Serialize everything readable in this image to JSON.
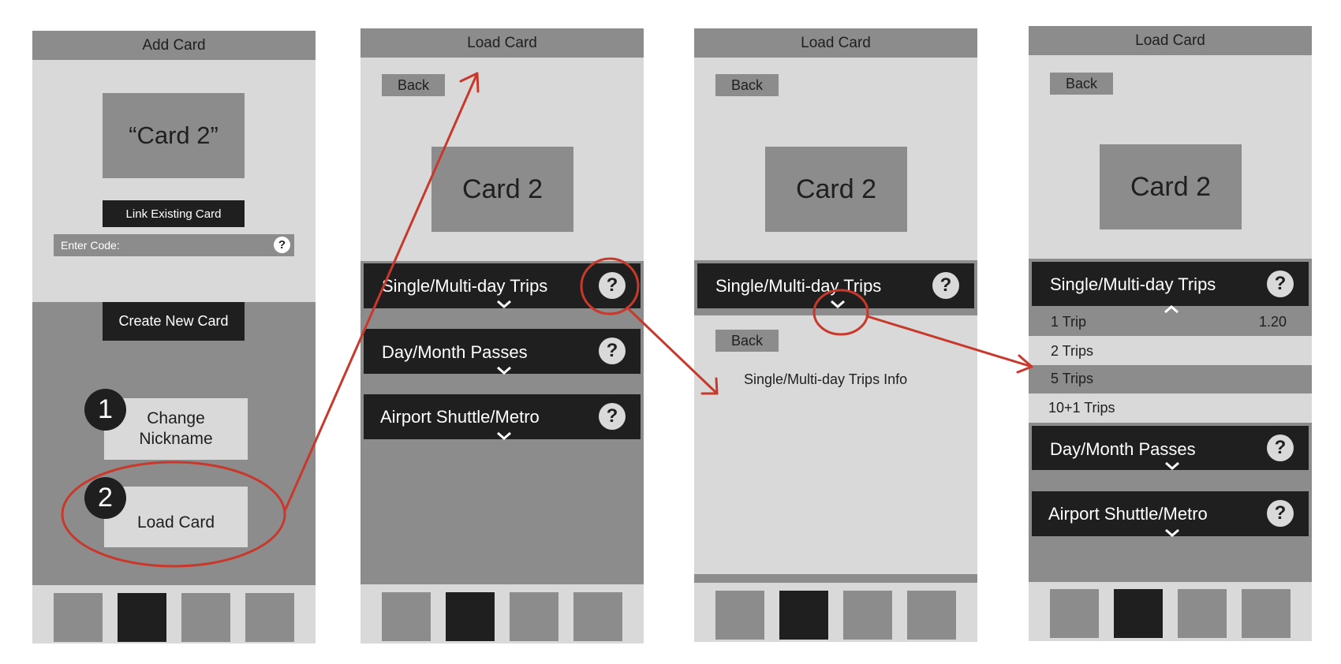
{
  "screens": {
    "add_card": {
      "title": "Add Card",
      "card_name": "“Card 2”",
      "link_button": "Link Existing Card",
      "code_placeholder": "Enter Code:",
      "create_button": "Create New Card",
      "step1_number": "1",
      "change_nickname": "Change Nickname",
      "step2_number": "2",
      "load_card_button": "Load Card"
    },
    "load_card_1": {
      "title": "Load Card",
      "back": "Back",
      "card_name": "Card 2",
      "sections": [
        "Single/Multi-day Trips",
        "Day/Month Passes",
        "Airport Shuttle/Metro"
      ]
    },
    "load_card_2": {
      "title": "Load Card",
      "back": "Back",
      "card_name": "Card 2",
      "section": "Single/Multi-day Trips",
      "info_back": "Back",
      "info_text": "Single/Multi-day Trips Info"
    },
    "load_card_3": {
      "title": "Load Card",
      "back": "Back",
      "card_name": "Card 2",
      "section": "Single/Multi-day Trips",
      "options": [
        {
          "label": "1 Trip",
          "price": "1.20"
        },
        {
          "label": "2 Trips",
          "price": ""
        },
        {
          "label": "5 Trips",
          "price": ""
        },
        {
          "label": "10+1 Trips",
          "price": ""
        }
      ],
      "sections_after": [
        "Day/Month Passes",
        "Airport Shuttle/Metro"
      ]
    }
  },
  "help_glyph": "?",
  "icons": {
    "help": "question-mark-icon",
    "expand": "chevron-down-icon",
    "collapse": "chevron-up-icon"
  },
  "colors": {
    "annotation": "#c8382b",
    "dark": "#1f1f1f",
    "mid": "#8c8c8c",
    "light": "#d9d9d9"
  }
}
